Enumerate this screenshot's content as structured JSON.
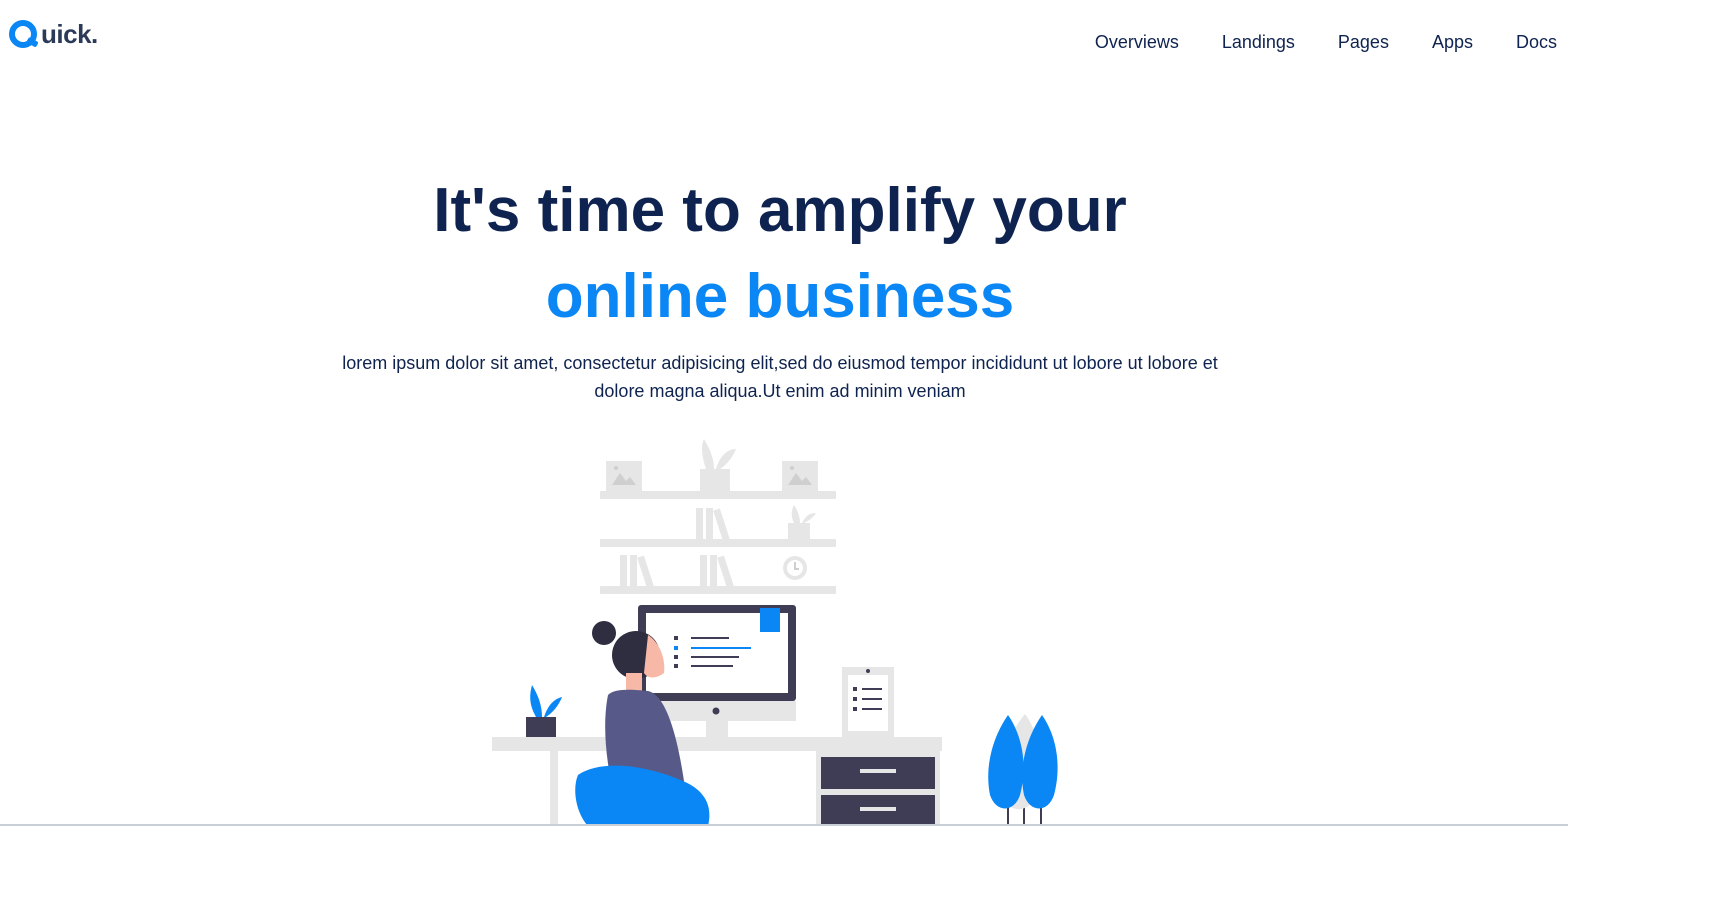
{
  "brand": {
    "name": "uick.",
    "logo_letter": "Q"
  },
  "nav": {
    "items": [
      {
        "label": "Overviews"
      },
      {
        "label": "Landings"
      },
      {
        "label": "Pages"
      },
      {
        "label": "Apps"
      },
      {
        "label": "Docs"
      }
    ]
  },
  "hero": {
    "title_line1": "It's time to amplify your",
    "title_line2": "online business",
    "subtitle": "lorem ipsum dolor sit amet, consectetur adipisicing elit,sed do eiusmod tempor incididunt ut lobore ut lobore et dolore magna aliqua.Ut enim ad minim veniam"
  },
  "colors": {
    "navy": "#0f2350",
    "accent": "#0a87f4",
    "shelf_grey": "#e6e6e6",
    "desk_dark": "#3f3d56"
  },
  "icons": [
    "logo-q-icon",
    "work-desk-illustration"
  ]
}
